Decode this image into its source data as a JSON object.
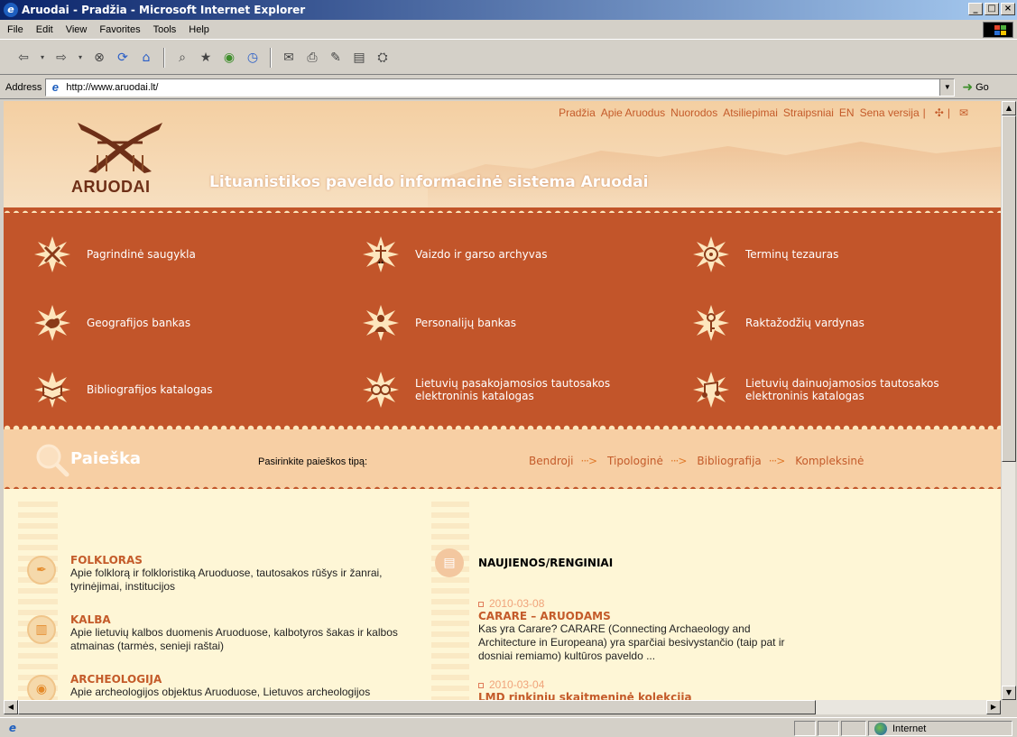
{
  "window": {
    "title": "Aruodai - Pradžia - Microsoft Internet Explorer",
    "minimize": "_",
    "maximize": "□",
    "close": "×"
  },
  "menu": [
    "File",
    "Edit",
    "View",
    "Favorites",
    "Tools",
    "Help"
  ],
  "address": {
    "label": "Address",
    "url": "http://www.aruodai.lt/",
    "go_label": "Go"
  },
  "topnav": [
    "Pradžia",
    "Apie Aruodus",
    "Nuorodos",
    "Atsiliepimai",
    "Straipsniai",
    "EN",
    "Sena versija"
  ],
  "brand": {
    "logo_text": "ARUODAI",
    "tagline": "Lituanistikos paveldo informacinė sistema Aruodai"
  },
  "categories": [
    {
      "label": "Pagrindinė saugykla"
    },
    {
      "label": "Vaizdo ir garso archyvas"
    },
    {
      "label": "Terminų tezauras"
    },
    {
      "label": "Geografijos bankas"
    },
    {
      "label": "Personalijų bankas"
    },
    {
      "label": "Raktažodžių vardynas"
    },
    {
      "label": "Bibliografijos katalogas"
    },
    {
      "label_1": "Lietuvių pasakojamosios tautosakos",
      "label_2": "elektroninis katalogas"
    },
    {
      "label_1": "Lietuvių dainuojamosios tautosakos",
      "label_2": "elektroninis katalogas"
    }
  ],
  "search": {
    "title": "Paieška",
    "prompt": "Pasirinkite paieškos tipą:",
    "types": [
      "Bendroji",
      "Tipologinė",
      "Bibliografija",
      "Kompleksinė"
    ],
    "arrow": "···>"
  },
  "sections": [
    {
      "title": "FOLKLORAS",
      "desc": "Apie folklorą ir folkloristiką Aruoduose, tautosakos rūšys ir žanrai, tyrinėjimai, institucijos"
    },
    {
      "title": "KALBA",
      "desc": "Apie lietuvių kalbos duomenis Aruoduose, kalbotyros šakas ir kalbos atmainas (tarmės, senieji raštai)"
    },
    {
      "title": "ARCHEOLOGIJA",
      "desc": "Apie archeologijos objektus Aruoduose, Lietuvos archeologijos"
    }
  ],
  "news": {
    "title": "NAUJIENOS/RENGINIAI",
    "items": [
      {
        "date": "2010-03-08",
        "headline": "CARARE – ARUODAMS",
        "body": "Kas yra Carare? CARARE (Connecting Archaeology and Architecture in Europeana) yra sparčiai besivystančio (taip pat ir dosniai remiamo) kultūros paveldo ..."
      },
      {
        "date": "2010-03-04",
        "headline": "LMD rinkinių skaitmeninė kolekcija",
        "body": ""
      }
    ]
  },
  "status": {
    "zone": "Internet"
  },
  "colors": {
    "band": "#c2552a",
    "accent": "#c45b2a",
    "content_bg": "#fef6d6",
    "search_bg": "#f7cfa4"
  }
}
